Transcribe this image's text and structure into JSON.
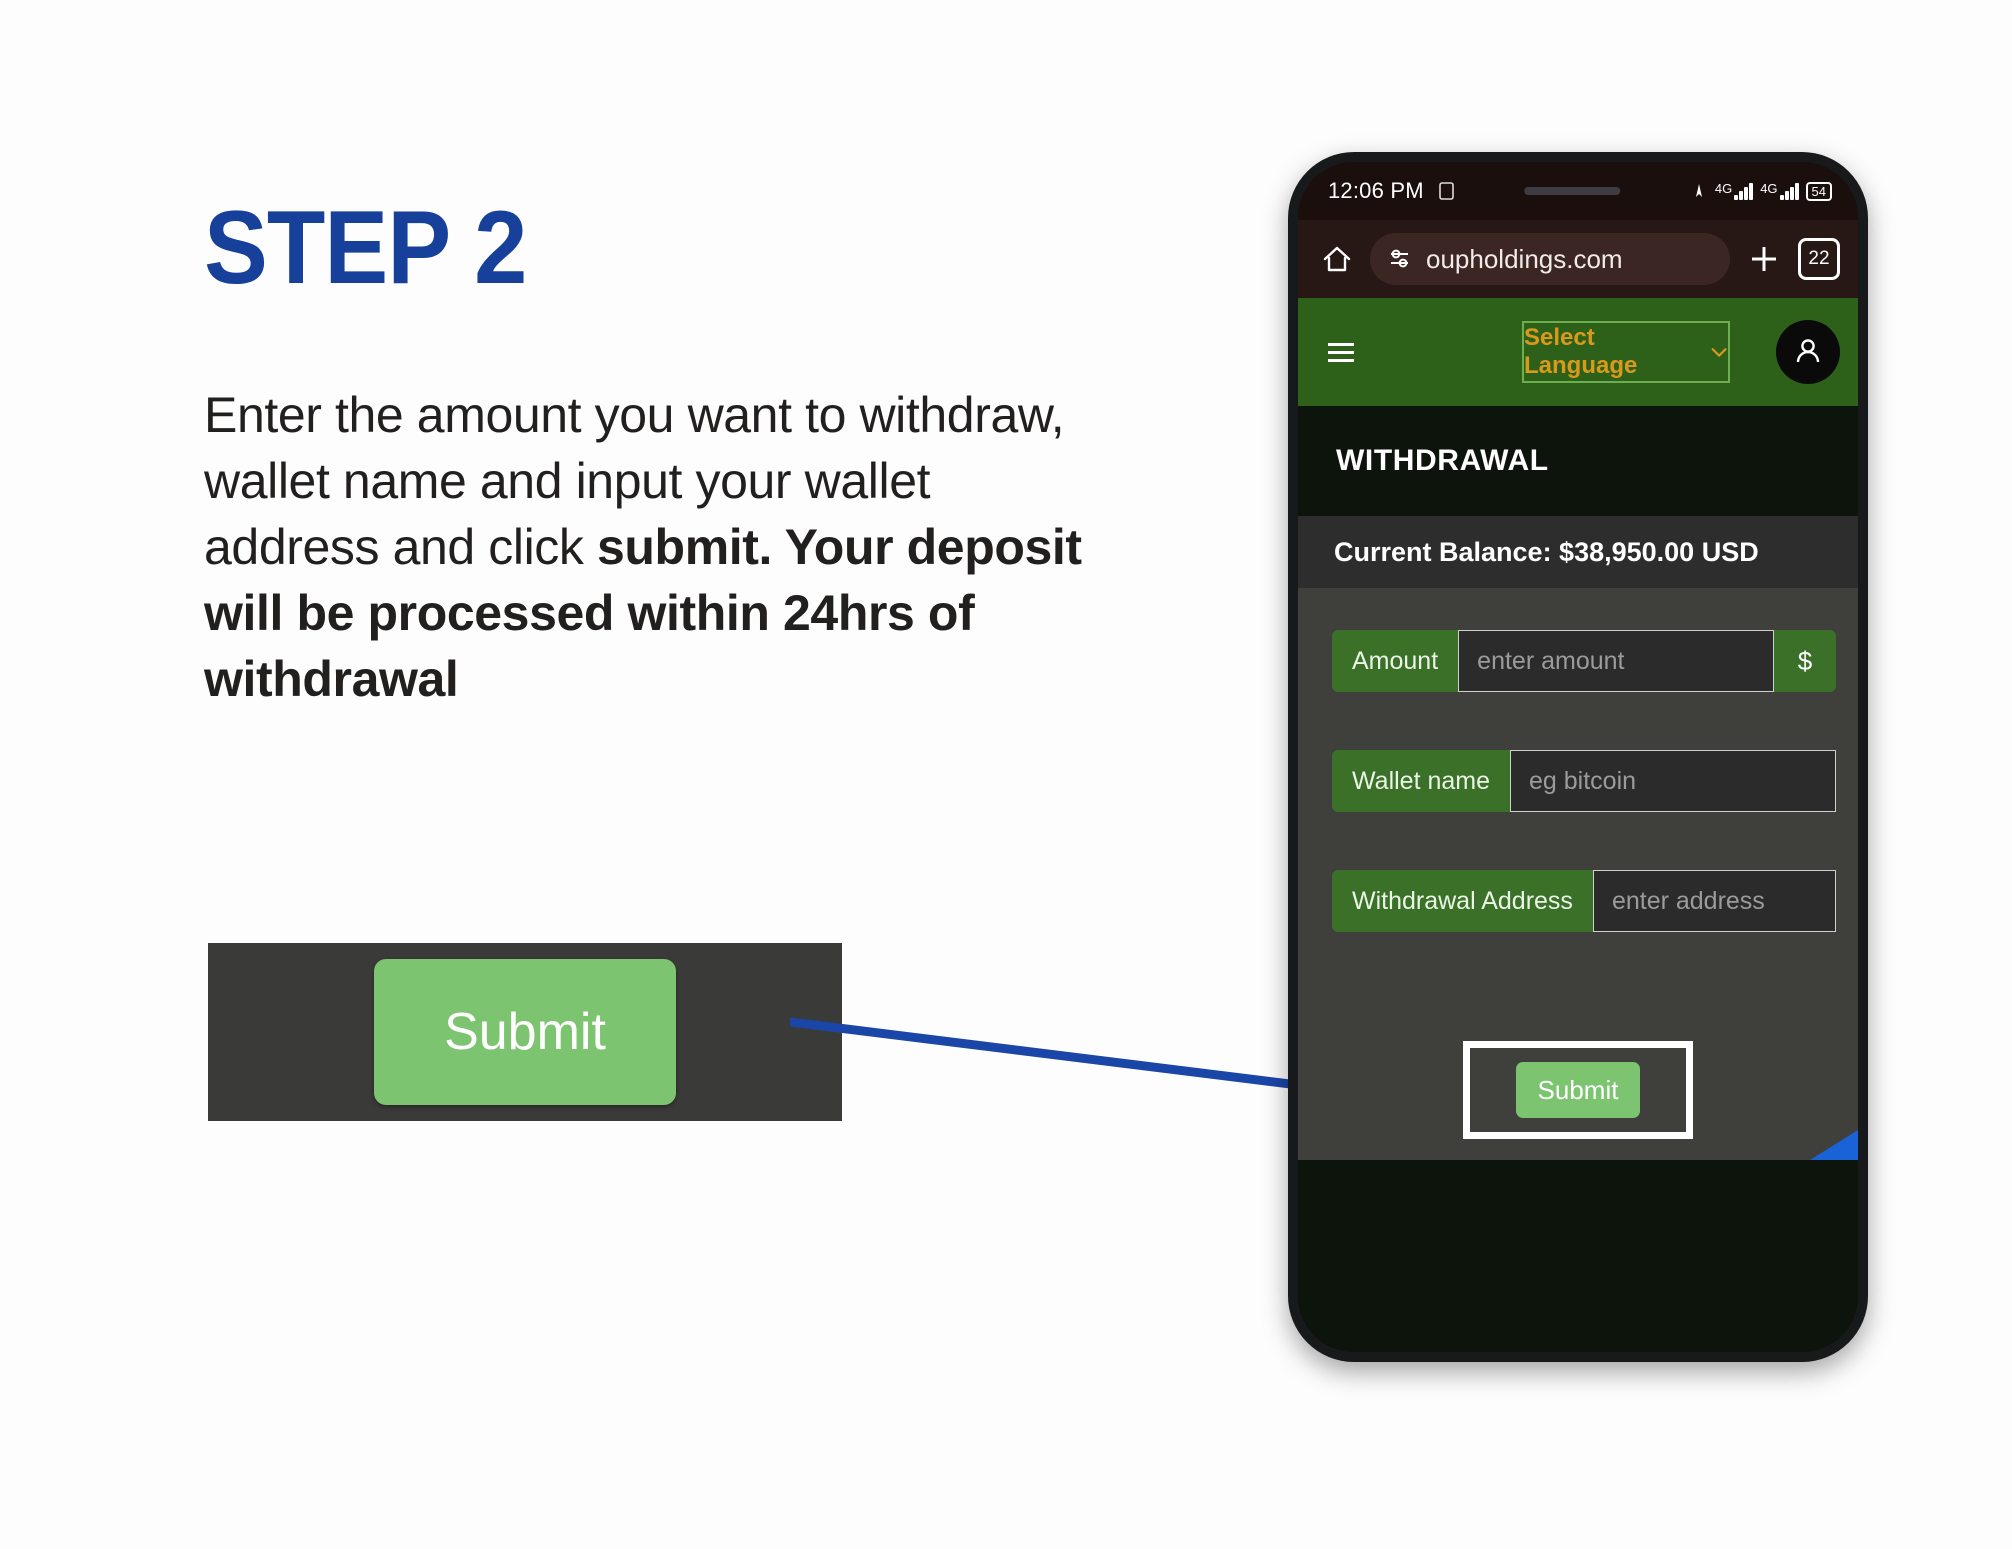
{
  "slide": {
    "title": "STEP 2",
    "body_regular": "Enter the amount you want to withdraw, wallet name and input your wallet address and click ",
    "body_bold": "submit. Your deposit will be processed within 24hrs of withdrawal",
    "title_color": "#17409a"
  },
  "callout": {
    "submit_label": "Submit",
    "panel_color": "#3a3a38",
    "button_color": "#7cc46f"
  },
  "phone": {
    "status_bar": {
      "time": "12:06 PM",
      "network_label_1": "4G",
      "network_label_2": "4G",
      "battery_level": "54"
    },
    "browser": {
      "url": "oupholdings.com",
      "new_tab_label": "+",
      "tab_count": "22"
    },
    "app_header": {
      "language_label": "Select Language",
      "language_color": "#d99a1c",
      "header_color": "#2d6019"
    },
    "page": {
      "title": "WITHDRAWAL",
      "balance": "Current Balance: $38,950.00 USD",
      "fields": [
        {
          "label": "Amount",
          "placeholder": "enter amount",
          "suffix": "$"
        },
        {
          "label": "Wallet name",
          "placeholder": "eg bitcoin",
          "suffix": ""
        },
        {
          "label": "Withdrawal Address",
          "placeholder": "enter address",
          "suffix": ""
        }
      ],
      "submit_label": "Submit"
    }
  }
}
